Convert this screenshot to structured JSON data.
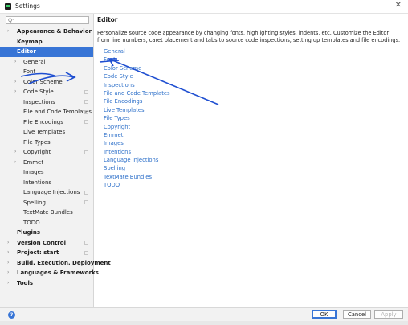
{
  "window": {
    "title": "Settings",
    "close_glyph": "✕"
  },
  "search": {
    "placeholder": "",
    "icon": "search-icon",
    "glyph": "Q·"
  },
  "tree": [
    {
      "label": "Appearance & Behavior",
      "bold": true,
      "chevron": true,
      "indent": 0
    },
    {
      "label": "Keymap",
      "bold": true,
      "chevron": false,
      "indent": 0
    },
    {
      "label": "Editor",
      "bold": true,
      "chevron": false,
      "indent": 0,
      "selected": true,
      "expanded": true
    },
    {
      "label": "General",
      "bold": false,
      "chevron": true,
      "indent": 1
    },
    {
      "label": "Font",
      "bold": false,
      "chevron": false,
      "indent": 1
    },
    {
      "label": "Color Scheme",
      "bold": false,
      "chevron": true,
      "indent": 1
    },
    {
      "label": "Code Style",
      "bold": false,
      "chevron": true,
      "indent": 1,
      "project_icon": true
    },
    {
      "label": "Inspections",
      "bold": false,
      "chevron": false,
      "indent": 1,
      "project_icon": true
    },
    {
      "label": "File and Code Templates",
      "bold": false,
      "chevron": false,
      "indent": 1,
      "project_icon": true
    },
    {
      "label": "File Encodings",
      "bold": false,
      "chevron": false,
      "indent": 1,
      "project_icon": true
    },
    {
      "label": "Live Templates",
      "bold": false,
      "chevron": false,
      "indent": 1
    },
    {
      "label": "File Types",
      "bold": false,
      "chevron": false,
      "indent": 1
    },
    {
      "label": "Copyright",
      "bold": false,
      "chevron": true,
      "indent": 1,
      "project_icon": true
    },
    {
      "label": "Emmet",
      "bold": false,
      "chevron": true,
      "indent": 1
    },
    {
      "label": "Images",
      "bold": false,
      "chevron": false,
      "indent": 1
    },
    {
      "label": "Intentions",
      "bold": false,
      "chevron": false,
      "indent": 1
    },
    {
      "label": "Language Injections",
      "bold": false,
      "chevron": false,
      "indent": 1,
      "project_icon": true
    },
    {
      "label": "Spelling",
      "bold": false,
      "chevron": false,
      "indent": 1,
      "project_icon": true
    },
    {
      "label": "TextMate Bundles",
      "bold": false,
      "chevron": false,
      "indent": 1
    },
    {
      "label": "TODO",
      "bold": false,
      "chevron": false,
      "indent": 1
    },
    {
      "label": "Plugins",
      "bold": true,
      "chevron": false,
      "indent": 0
    },
    {
      "label": "Version Control",
      "bold": true,
      "chevron": true,
      "indent": 0,
      "project_icon": true
    },
    {
      "label": "Project: start",
      "bold": true,
      "chevron": true,
      "indent": 0,
      "project_icon": true
    },
    {
      "label": "Build, Execution, Deployment",
      "bold": true,
      "chevron": true,
      "indent": 0
    },
    {
      "label": "Languages & Frameworks",
      "bold": true,
      "chevron": true,
      "indent": 0
    },
    {
      "label": "Tools",
      "bold": true,
      "chevron": true,
      "indent": 0
    }
  ],
  "content": {
    "heading": "Editor",
    "description": "Personalize source code appearance by changing fonts, highlighting styles, indents, etc. Customize the Editor from line numbers, caret placement and tabs to source code inspections, setting up templates and file encodings.",
    "links": [
      "General",
      "Font",
      "Color Scheme",
      "Code Style",
      "Inspections",
      "File and Code Templates",
      "File Encodings",
      "Live Templates",
      "File Types",
      "Copyright",
      "Emmet",
      "Images",
      "Intentions",
      "Language Injections",
      "Spelling",
      "TextMate Bundles",
      "TODO"
    ]
  },
  "footer": {
    "help_glyph": "?",
    "ok_label": "OK",
    "cancel_label": "Cancel",
    "apply_label": "Apply"
  },
  "colors": {
    "selection": "#3875d6",
    "link": "#2c6fc9",
    "annotation": "#1f4fd1"
  },
  "chevron_glyph": "›"
}
